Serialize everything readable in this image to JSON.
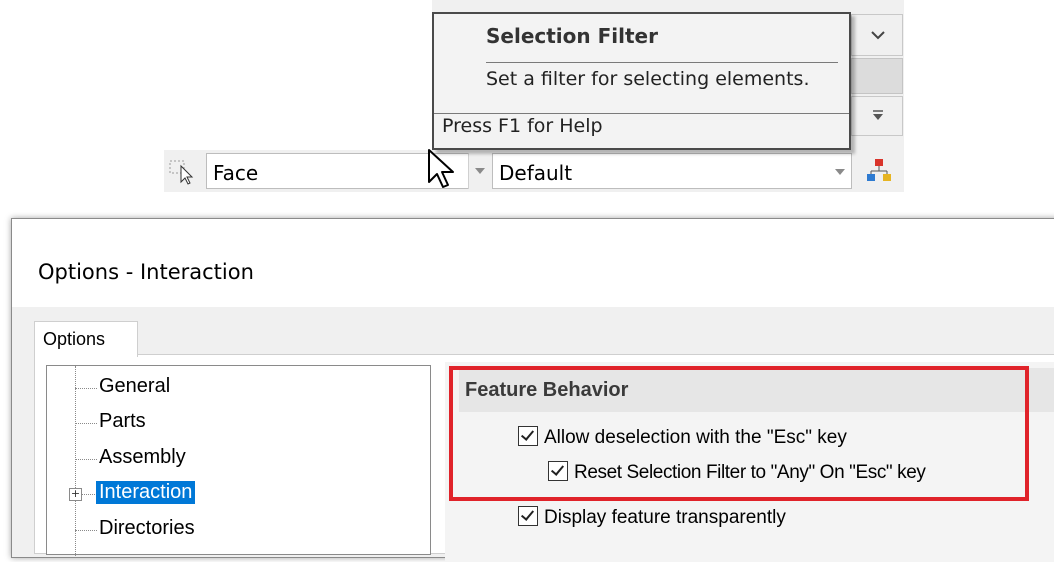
{
  "tooltip": {
    "title": "Selection Filter",
    "description": "Set a filter for selecting elements.",
    "help": "Press F1 for Help"
  },
  "selection_bar": {
    "filter_value": "Face",
    "config_value": "Default"
  },
  "dialog": {
    "title": "Options - Interaction",
    "tab_label": "Options",
    "tree": [
      {
        "label": "General",
        "expandable": false,
        "selected": false
      },
      {
        "label": "Parts",
        "expandable": false,
        "selected": false
      },
      {
        "label": "Assembly",
        "expandable": false,
        "selected": false
      },
      {
        "label": "Interaction",
        "expandable": true,
        "selected": true
      },
      {
        "label": "Directories",
        "expandable": false,
        "selected": false
      }
    ],
    "section_title": "Feature Behavior",
    "checkboxes": [
      {
        "label": "Allow deselection with the \"Esc\" key",
        "checked": true
      },
      {
        "label": "Reset Selection Filter to \"Any\" On \"Esc\" key",
        "checked": true
      },
      {
        "label": "Display feature transparently",
        "checked": true
      }
    ]
  },
  "colors": {
    "highlight": "#e0232a",
    "selection": "#0078d7"
  }
}
